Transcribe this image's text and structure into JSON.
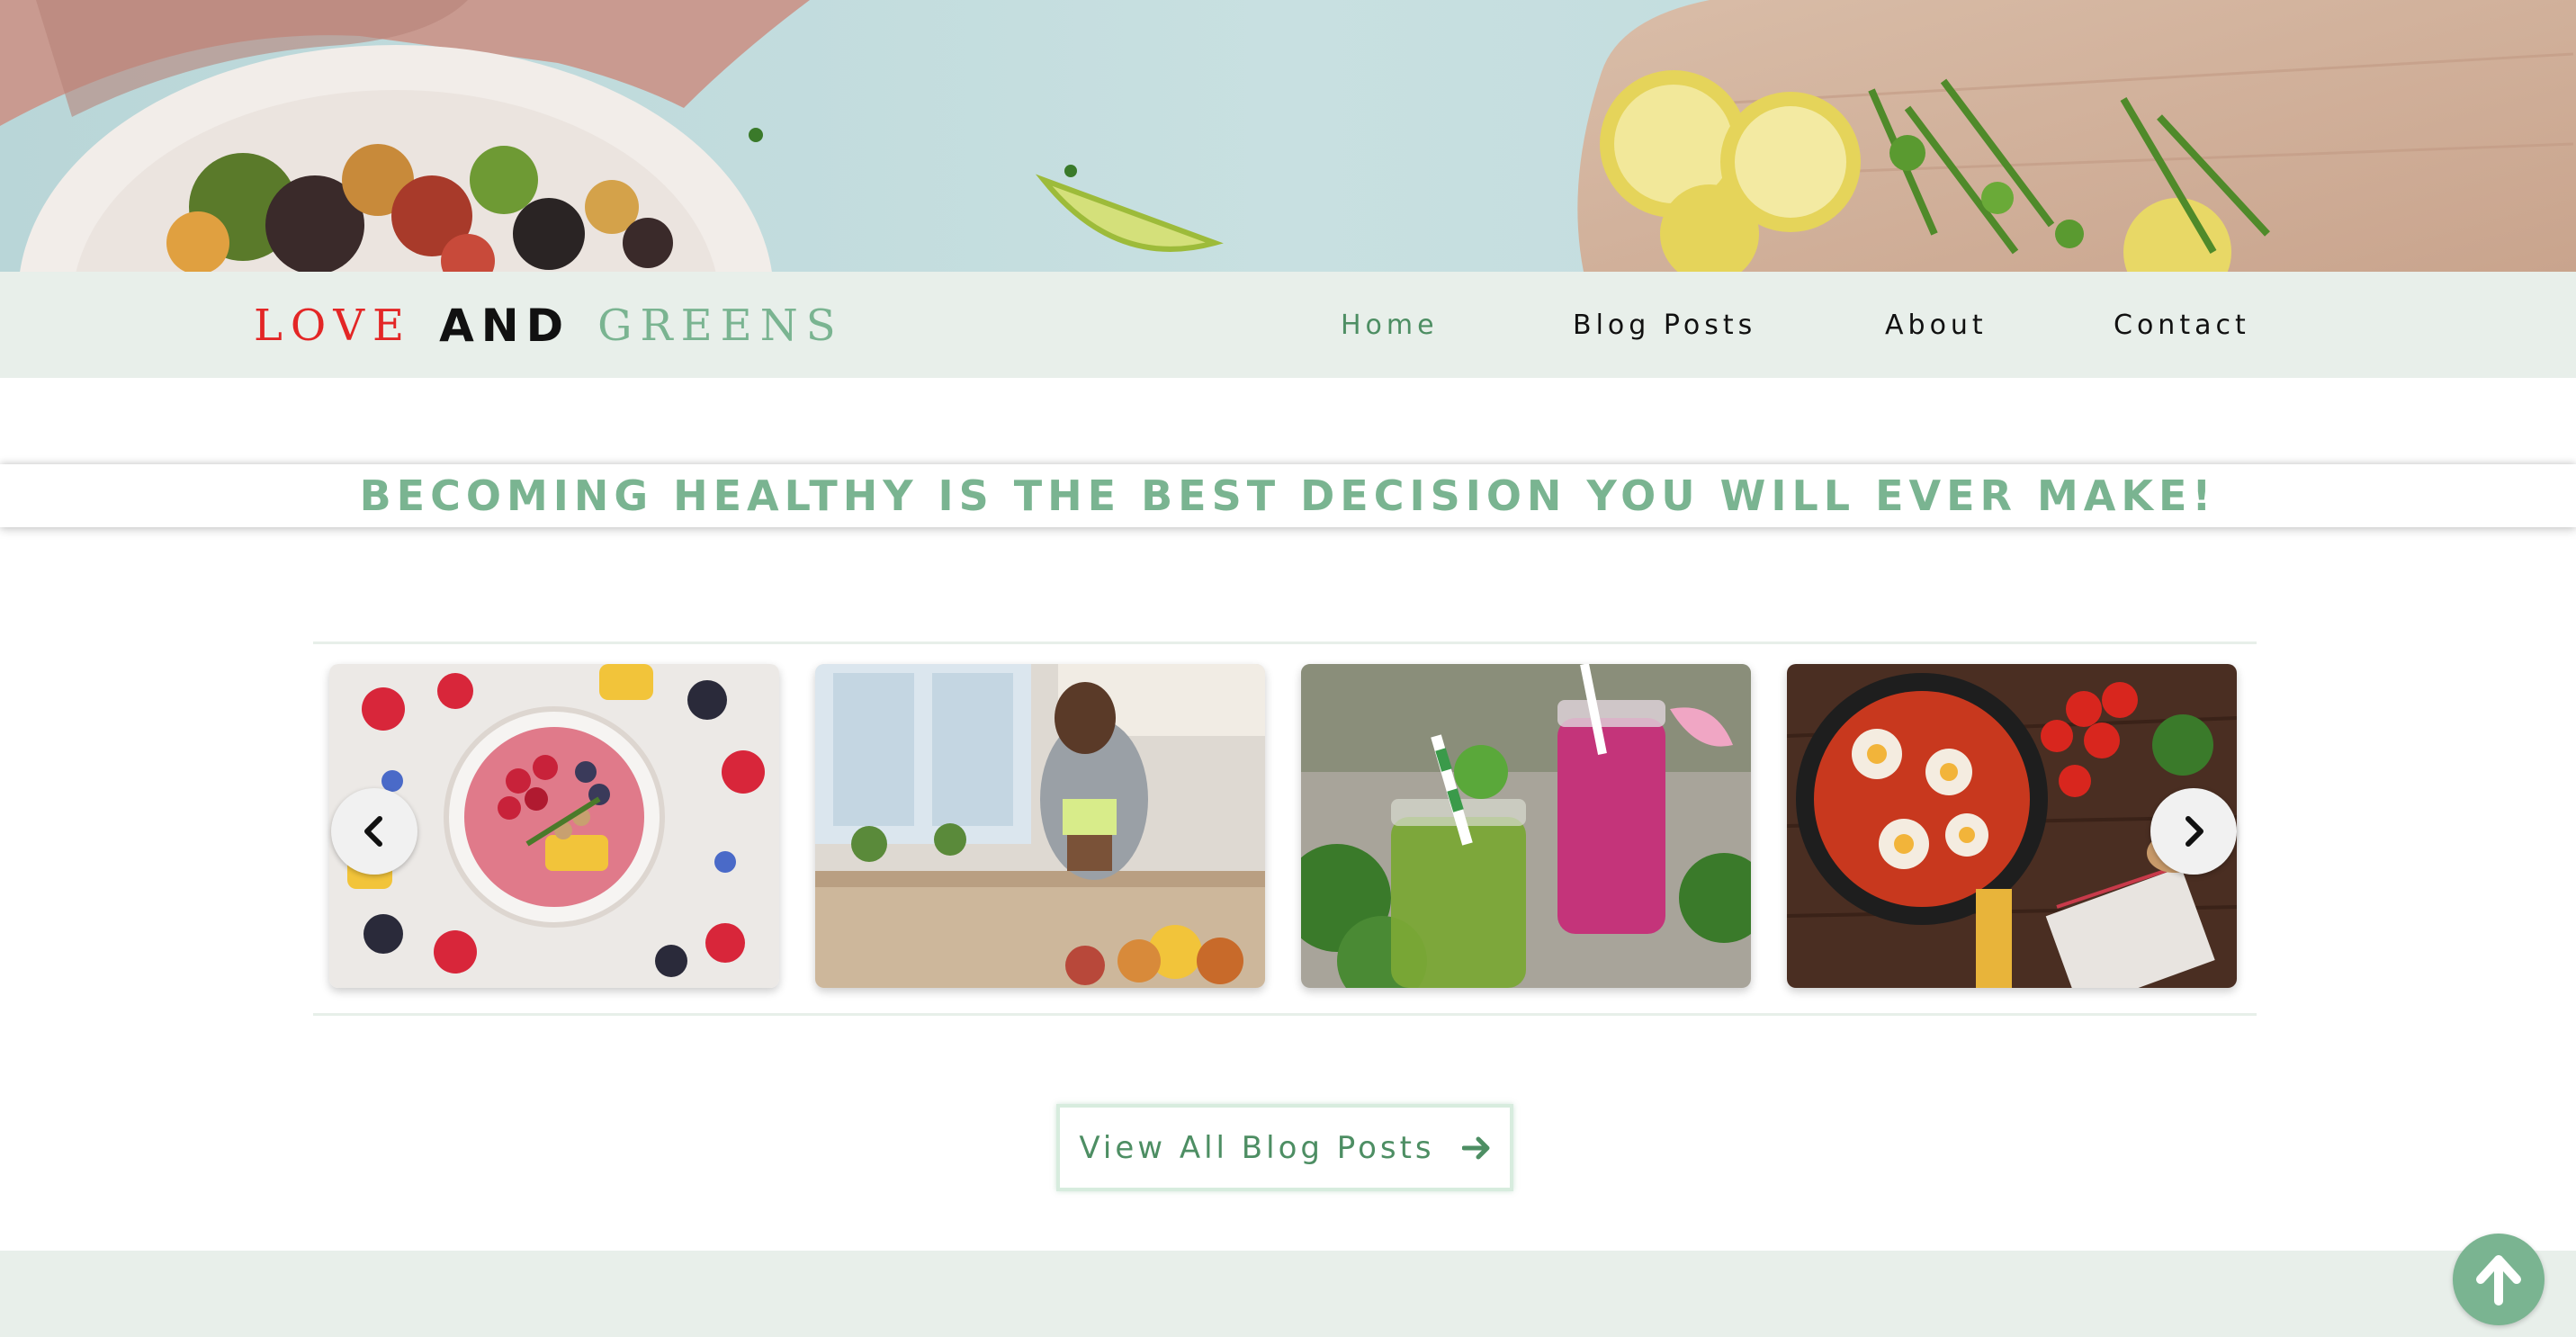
{
  "brand": {
    "love": "LOVE",
    "and": "AND",
    "greens": "GREENS"
  },
  "nav": {
    "items": [
      {
        "label": "Home",
        "active": true
      },
      {
        "label": "Blog Posts",
        "active": false
      },
      {
        "label": "About",
        "active": false
      },
      {
        "label": "Contact",
        "active": false
      }
    ]
  },
  "tagline": "BECOMING HEALTHY IS THE BEST DECISION YOU WILL EVER MAKE!",
  "carousel": {
    "cards": [
      {
        "image": "fruit-bowl-photo"
      },
      {
        "image": "woman-cooking-photo"
      },
      {
        "image": "smoothies-photo"
      },
      {
        "image": "shakshuka-pan-photo"
      }
    ],
    "prev_icon": "chevron-left-icon",
    "next_icon": "chevron-right-icon"
  },
  "view_all": {
    "label": "View All Blog Posts",
    "icon": "arrow-right-icon"
  },
  "scroll_top_icon": "arrow-up-icon",
  "colors": {
    "accent_green": "#7ab491",
    "dark_green": "#4d8e63",
    "nav_bg": "#e8efea",
    "logo_red": "#e32626"
  }
}
